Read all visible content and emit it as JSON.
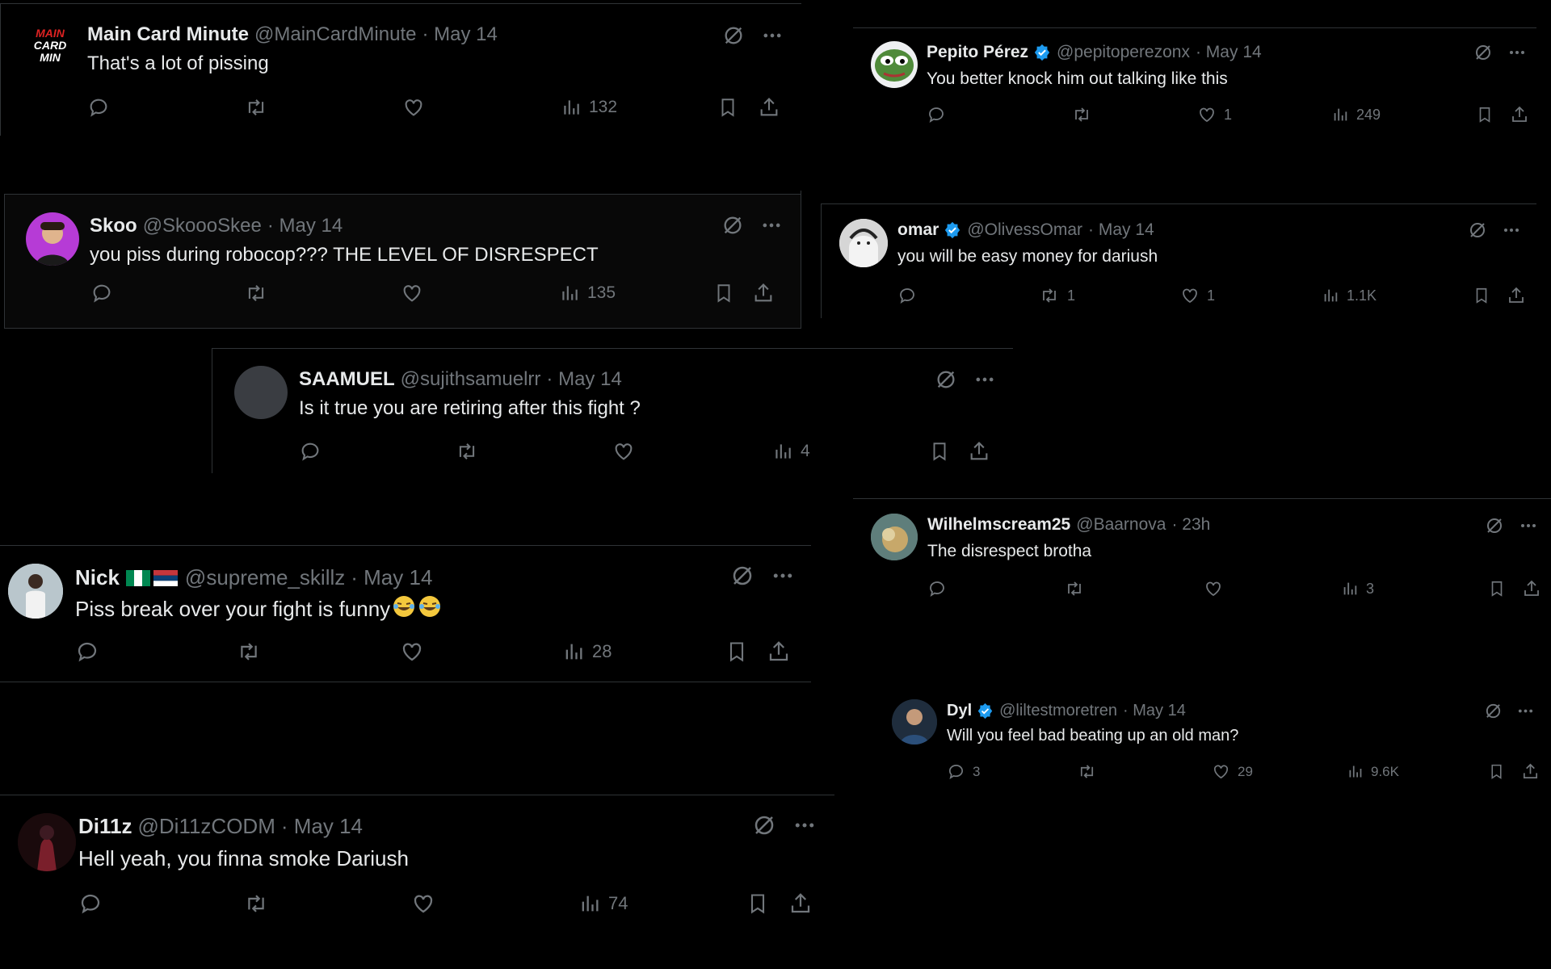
{
  "colors": {
    "background": "#000000",
    "text": "#e7e9ea",
    "muted": "#71767b",
    "verified": "#1d9bf0",
    "divider": "#2f3336"
  },
  "tweets": [
    {
      "name": "Main Card Minute",
      "handle": "@MainCardMinute",
      "date": "· May 14",
      "text": "That's a lot of pissing",
      "avatar_text": [
        "MAIN",
        "CARD",
        "MIN"
      ],
      "replies": "",
      "retweets": "",
      "likes": "",
      "views": "132"
    },
    {
      "name": "Skoo",
      "handle": "@SkoooSkee",
      "date": "· May 14",
      "text": "you piss during robocop??? THE LEVEL OF DISRESPECT",
      "replies": "",
      "retweets": "",
      "likes": "",
      "views": "135"
    },
    {
      "name": "SAAMUEL",
      "handle": "@sujithsamuelrr",
      "date": "· May 14",
      "text": "Is it true you are retiring after this fight ?",
      "replies": "",
      "retweets": "",
      "likes": "",
      "views": "4"
    },
    {
      "name": "Nick",
      "handle": "@supreme_skillz",
      "date": "· May 14",
      "text": "Piss break over your fight is funny",
      "flags": [
        "nigeria-flag",
        "serbia-flag"
      ],
      "emoji": [
        "face-with-tears-of-joy",
        "face-with-tears-of-joy"
      ],
      "replies": "",
      "retweets": "",
      "likes": "",
      "views": "28"
    },
    {
      "name": "Di11z",
      "handle": "@Di11zCODM",
      "date": "· May 14",
      "text": "Hell yeah, you finna smoke Dariush",
      "replies": "",
      "retweets": "",
      "likes": "",
      "views": "74"
    },
    {
      "name": "Pepito Pérez",
      "handle": "@pepitoperezonx",
      "date": "· May 14",
      "text": "You better knock him out talking like this",
      "verified": true,
      "replies": "",
      "retweets": "",
      "likes": "1",
      "views": "249"
    },
    {
      "name": "omar",
      "handle": "@OlivessOmar",
      "date": "· May 14",
      "text": "you will be easy money for dariush",
      "verified": true,
      "replies": "",
      "retweets": "1",
      "likes": "1",
      "views": "1.1K"
    },
    {
      "name": "Wilhelmscream25",
      "handle": "@Baarnova",
      "date": "· 23h",
      "text": "The disrespect brotha",
      "replies": "",
      "retweets": "",
      "likes": "",
      "views": "3"
    },
    {
      "name": "Dyl",
      "handle": "@liltestmoretren",
      "date": "· May 14",
      "text": "Will you feel bad beating up an old man?",
      "verified": true,
      "replies": "3",
      "retweets": "",
      "likes": "29",
      "views": "9.6K"
    }
  ]
}
